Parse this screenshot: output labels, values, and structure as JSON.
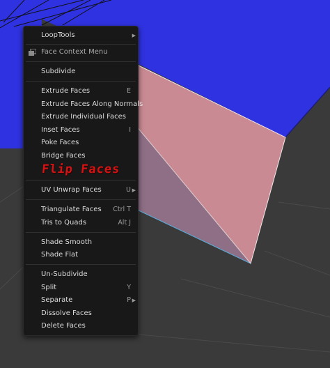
{
  "colors": {
    "background_blue": "#2f32e0",
    "viewport_grey": "#3a3a3a",
    "selected_face": "#c98a93",
    "menu_bg": "#181818",
    "menu_text": "#dcdcdc",
    "annotation_red": "#d41414"
  },
  "menu": {
    "items": [
      {
        "label": "LoopTools",
        "shortcut": "",
        "submenu": true
      },
      {
        "label": "Face Context Menu",
        "shortcut": "",
        "submenu": false,
        "icon": "pin-icon"
      },
      {
        "label": "Subdivide",
        "shortcut": "",
        "submenu": false
      },
      {
        "label": "Extrude Faces",
        "shortcut": "E",
        "submenu": false
      },
      {
        "label": "Extrude Faces Along Normals",
        "shortcut": "",
        "submenu": false
      },
      {
        "label": "Extrude Individual Faces",
        "shortcut": "",
        "submenu": false
      },
      {
        "label": "Inset Faces",
        "shortcut": "I",
        "submenu": false
      },
      {
        "label": "Poke Faces",
        "shortcut": "",
        "submenu": false
      },
      {
        "label": "Bridge Faces",
        "shortcut": "",
        "submenu": false
      },
      {
        "label": "UV Unwrap Faces",
        "shortcut": "U",
        "submenu": true
      },
      {
        "label": "Triangulate Faces",
        "shortcut": "Ctrl T",
        "submenu": false
      },
      {
        "label": "Tris to Quads",
        "shortcut": "Alt J",
        "submenu": false
      },
      {
        "label": "Shade Smooth",
        "shortcut": "",
        "submenu": false
      },
      {
        "label": "Shade Flat",
        "shortcut": "",
        "submenu": false
      },
      {
        "label": "Un-Subdivide",
        "shortcut": "",
        "submenu": false
      },
      {
        "label": "Split",
        "shortcut": "Y",
        "submenu": false
      },
      {
        "label": "Separate",
        "shortcut": "P",
        "submenu": true
      },
      {
        "label": "Dissolve Faces",
        "shortcut": "",
        "submenu": false
      },
      {
        "label": "Delete Faces",
        "shortcut": "",
        "submenu": false
      }
    ],
    "submenu_arrow": "▶"
  },
  "annotation": {
    "text": "Flip Faces"
  }
}
